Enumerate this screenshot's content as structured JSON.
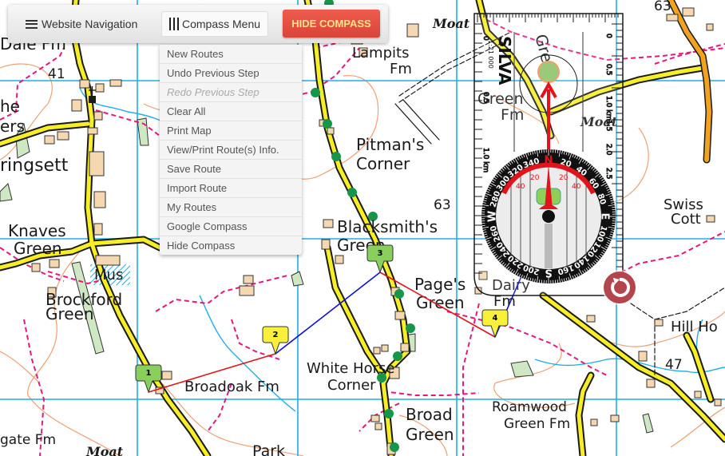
{
  "toolbar": {
    "website_nav_label": "Website Navigation",
    "compass_menu_label": "Compass Menu",
    "hide_compass_label": "HIDE COMPASS"
  },
  "compass_menu": {
    "items": [
      {
        "label": "New Routes",
        "enabled": true
      },
      {
        "label": "Undo Previous Step",
        "enabled": true
      },
      {
        "label": "Redo Previous Step",
        "enabled": false
      },
      {
        "label": "Clear All",
        "enabled": true
      },
      {
        "label": "Print Map",
        "enabled": true
      },
      {
        "label": "View/Print Route(s) Info.",
        "enabled": true
      },
      {
        "label": "Save Route",
        "enabled": true
      },
      {
        "label": "Import Route",
        "enabled": true
      },
      {
        "label": "My Routes",
        "enabled": true
      },
      {
        "label": "Google Compass",
        "enabled": true
      },
      {
        "label": "Hide Compass",
        "enabled": true
      }
    ]
  },
  "map": {
    "place_labels": {
      "dale_fm": "Dale Fm",
      "grid_41": "41",
      "ringsett": "ringsett",
      "knaves": "Knaves",
      "knaves_green": "Green",
      "mus": "Mus",
      "brockford": "Brockford",
      "brockford_green": "Green",
      "broadoak": "Broadoak Fm",
      "gate_fm": "gate Fm",
      "moat1": "Moat",
      "park": "Park",
      "lampits": "Lampits",
      "lampits_fm": "Fm",
      "moat2": "Moat",
      "pitmans": "Pitman's",
      "pitmans_corner": "Corner",
      "grid_63a": "63",
      "blacksmiths": "Blacksmith's",
      "blacksmiths_green": "Green",
      "pages": "Page's",
      "pages_green": "Green",
      "dairy": "Dairy",
      "dairy_fm": "Fm",
      "white_horse": "White Horse",
      "white_horse_corner": "Corner",
      "broad": "Broad",
      "broad_green": "Green",
      "roamwood": "Roamwood",
      "roamwood_green": "Green Fm",
      "green_top": "Green",
      "green_fm": "Green",
      "green_fm2": "Fm",
      "moat3": "Moat",
      "grid_63b": "63",
      "swiss": "Swiss",
      "swiss_cott": "Cott",
      "hill_ho": "Hill Ho",
      "grid_47": "47",
      "ers": "ers",
      "he": "he"
    },
    "route": {
      "waypoints": [
        {
          "label": "1",
          "marker_color": "green"
        },
        {
          "label": "2",
          "marker_color": "yellow"
        },
        {
          "label": "3",
          "marker_color": "green"
        },
        {
          "label": "4",
          "marker_color": "yellow"
        }
      ],
      "colors": {
        "leg_red": "#e3131b",
        "leg_blue": "#1010d8"
      }
    }
  },
  "compass": {
    "brand": "SILVA",
    "scale": "1:21 000",
    "ruler_left_labels": [
      "0",
      "0.5",
      "1.0 km"
    ],
    "ruler_right_labels": [
      "0",
      "0.5",
      "1.0 km",
      "1.5",
      "2.0",
      "2.5"
    ],
    "bezel_labels": [
      "N",
      "20",
      "40",
      "60",
      "80",
      "E",
      "100",
      "120",
      "140",
      "160",
      "S",
      "200",
      "220",
      "240",
      "260",
      "W",
      "280",
      "300",
      "320",
      "340"
    ],
    "declination_labels": [
      "40",
      "20",
      "20",
      "40"
    ],
    "heading_degrees": 0,
    "needle_color": "#e3131b"
  },
  "colors": {
    "grid_line": "#21aee6",
    "road_yellow": "#f7ee26",
    "road_orange": "#f2a21e",
    "footpath": "#e5187f",
    "contour": "#f0a070",
    "building": "#f5d8b0",
    "woodland": "#cfe8c4",
    "hide_button": "#e0493d",
    "reset_button": "#b5454c"
  }
}
